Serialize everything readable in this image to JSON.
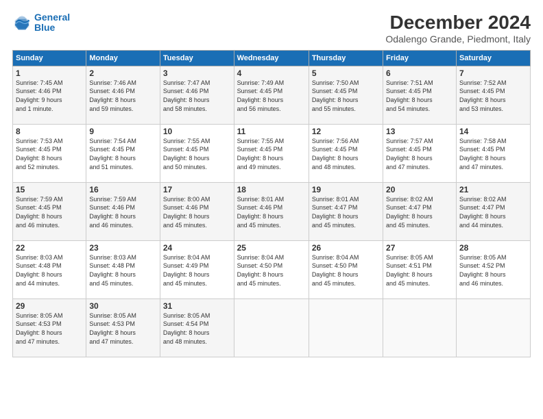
{
  "logo": {
    "line1": "General",
    "line2": "Blue"
  },
  "title": "December 2024",
  "subtitle": "Odalengo Grande, Piedmont, Italy",
  "days_header": [
    "Sunday",
    "Monday",
    "Tuesday",
    "Wednesday",
    "Thursday",
    "Friday",
    "Saturday"
  ],
  "weeks": [
    [
      {
        "day": "1",
        "info": "Sunrise: 7:45 AM\nSunset: 4:46 PM\nDaylight: 9 hours\nand 1 minute."
      },
      {
        "day": "2",
        "info": "Sunrise: 7:46 AM\nSunset: 4:46 PM\nDaylight: 8 hours\nand 59 minutes."
      },
      {
        "day": "3",
        "info": "Sunrise: 7:47 AM\nSunset: 4:46 PM\nDaylight: 8 hours\nand 58 minutes."
      },
      {
        "day": "4",
        "info": "Sunrise: 7:49 AM\nSunset: 4:45 PM\nDaylight: 8 hours\nand 56 minutes."
      },
      {
        "day": "5",
        "info": "Sunrise: 7:50 AM\nSunset: 4:45 PM\nDaylight: 8 hours\nand 55 minutes."
      },
      {
        "day": "6",
        "info": "Sunrise: 7:51 AM\nSunset: 4:45 PM\nDaylight: 8 hours\nand 54 minutes."
      },
      {
        "day": "7",
        "info": "Sunrise: 7:52 AM\nSunset: 4:45 PM\nDaylight: 8 hours\nand 53 minutes."
      }
    ],
    [
      {
        "day": "8",
        "info": "Sunrise: 7:53 AM\nSunset: 4:45 PM\nDaylight: 8 hours\nand 52 minutes."
      },
      {
        "day": "9",
        "info": "Sunrise: 7:54 AM\nSunset: 4:45 PM\nDaylight: 8 hours\nand 51 minutes."
      },
      {
        "day": "10",
        "info": "Sunrise: 7:55 AM\nSunset: 4:45 PM\nDaylight: 8 hours\nand 50 minutes."
      },
      {
        "day": "11",
        "info": "Sunrise: 7:55 AM\nSunset: 4:45 PM\nDaylight: 8 hours\nand 49 minutes."
      },
      {
        "day": "12",
        "info": "Sunrise: 7:56 AM\nSunset: 4:45 PM\nDaylight: 8 hours\nand 48 minutes."
      },
      {
        "day": "13",
        "info": "Sunrise: 7:57 AM\nSunset: 4:45 PM\nDaylight: 8 hours\nand 47 minutes."
      },
      {
        "day": "14",
        "info": "Sunrise: 7:58 AM\nSunset: 4:45 PM\nDaylight: 8 hours\nand 47 minutes."
      }
    ],
    [
      {
        "day": "15",
        "info": "Sunrise: 7:59 AM\nSunset: 4:45 PM\nDaylight: 8 hours\nand 46 minutes."
      },
      {
        "day": "16",
        "info": "Sunrise: 7:59 AM\nSunset: 4:46 PM\nDaylight: 8 hours\nand 46 minutes."
      },
      {
        "day": "17",
        "info": "Sunrise: 8:00 AM\nSunset: 4:46 PM\nDaylight: 8 hours\nand 45 minutes."
      },
      {
        "day": "18",
        "info": "Sunrise: 8:01 AM\nSunset: 4:46 PM\nDaylight: 8 hours\nand 45 minutes."
      },
      {
        "day": "19",
        "info": "Sunrise: 8:01 AM\nSunset: 4:47 PM\nDaylight: 8 hours\nand 45 minutes."
      },
      {
        "day": "20",
        "info": "Sunrise: 8:02 AM\nSunset: 4:47 PM\nDaylight: 8 hours\nand 45 minutes."
      },
      {
        "day": "21",
        "info": "Sunrise: 8:02 AM\nSunset: 4:47 PM\nDaylight: 8 hours\nand 44 minutes."
      }
    ],
    [
      {
        "day": "22",
        "info": "Sunrise: 8:03 AM\nSunset: 4:48 PM\nDaylight: 8 hours\nand 44 minutes."
      },
      {
        "day": "23",
        "info": "Sunrise: 8:03 AM\nSunset: 4:48 PM\nDaylight: 8 hours\nand 45 minutes."
      },
      {
        "day": "24",
        "info": "Sunrise: 8:04 AM\nSunset: 4:49 PM\nDaylight: 8 hours\nand 45 minutes."
      },
      {
        "day": "25",
        "info": "Sunrise: 8:04 AM\nSunset: 4:50 PM\nDaylight: 8 hours\nand 45 minutes."
      },
      {
        "day": "26",
        "info": "Sunrise: 8:04 AM\nSunset: 4:50 PM\nDaylight: 8 hours\nand 45 minutes."
      },
      {
        "day": "27",
        "info": "Sunrise: 8:05 AM\nSunset: 4:51 PM\nDaylight: 8 hours\nand 45 minutes."
      },
      {
        "day": "28",
        "info": "Sunrise: 8:05 AM\nSunset: 4:52 PM\nDaylight: 8 hours\nand 46 minutes."
      }
    ],
    [
      {
        "day": "29",
        "info": "Sunrise: 8:05 AM\nSunset: 4:53 PM\nDaylight: 8 hours\nand 47 minutes."
      },
      {
        "day": "30",
        "info": "Sunrise: 8:05 AM\nSunset: 4:53 PM\nDaylight: 8 hours\nand 47 minutes."
      },
      {
        "day": "31",
        "info": "Sunrise: 8:05 AM\nSunset: 4:54 PM\nDaylight: 8 hours\nand 48 minutes."
      },
      {
        "day": "",
        "info": ""
      },
      {
        "day": "",
        "info": ""
      },
      {
        "day": "",
        "info": ""
      },
      {
        "day": "",
        "info": ""
      }
    ]
  ]
}
